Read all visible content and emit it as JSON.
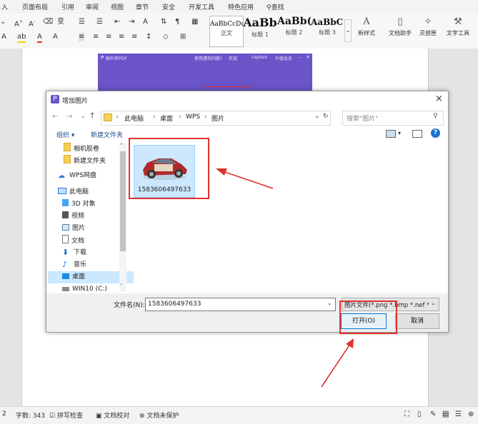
{
  "menu": {
    "items": [
      "入",
      "页面布局",
      "引用",
      "审阅",
      "视图",
      "章节",
      "安全",
      "开发工具",
      "特色应用",
      "查找"
    ]
  },
  "ribbon": {
    "styles": [
      {
        "sample": "AaBbCcDd",
        "name": "正文"
      },
      {
        "sample": "AaBb",
        "name": "标题 1"
      },
      {
        "sample": "AaBb(",
        "name": "标题 2"
      },
      {
        "sample": "AaBbC(",
        "name": "标题 3"
      }
    ],
    "new_style": "新样式",
    "doc_helper": "文档助手",
    "inspiration": "灵感匣",
    "text_tools": "文字工具"
  },
  "background_window": {
    "title": "图片转PDF",
    "link": "使用遇到问题?",
    "items": [
      "欢迎",
      "captain",
      "升级会员"
    ]
  },
  "dialog": {
    "title": "增加图片",
    "breadcrumb": [
      "此电脑",
      "桌面",
      "WPS",
      "图片"
    ],
    "search_placeholder": "搜索\"图片\"",
    "organize": "组织",
    "new_folder": "新建文件夹",
    "nav": [
      {
        "label": "相机胶卷",
        "icon": "folder-icon"
      },
      {
        "label": "新建文件夹",
        "icon": "folder-icon"
      },
      {
        "label": "WPS网盘",
        "icon": "cloud-icon"
      },
      {
        "label": "此电脑",
        "icon": "computer-icon"
      },
      {
        "label": "3D 对象",
        "icon": "cube-icon"
      },
      {
        "label": "视频",
        "icon": "video-icon"
      },
      {
        "label": "图片",
        "icon": "picture-icon"
      },
      {
        "label": "文档",
        "icon": "document-icon"
      },
      {
        "label": "下载",
        "icon": "download-icon"
      },
      {
        "label": "音乐",
        "icon": "music-icon"
      },
      {
        "label": "桌面",
        "icon": "desktop-icon"
      },
      {
        "label": "WIN10 (C:)",
        "icon": "drive-icon"
      }
    ],
    "file": {
      "name": "1583606497633"
    },
    "filename_label": "文件名(N):",
    "filename_value": "1583606497633",
    "filetype_value": "图片文件(*.png *.bmp *.nef *.",
    "open_button": "打开(O)",
    "cancel_button": "取消"
  },
  "statusbar": {
    "page": "2",
    "word_count": "字数: 343",
    "spell_check": "拼写检查",
    "proofread": "文档校对",
    "protect": "文档未保护"
  },
  "colors": {
    "accent_purple": "#6b53c8",
    "annotation_red": "#e0322d",
    "selection_blue": "#cce8ff"
  }
}
